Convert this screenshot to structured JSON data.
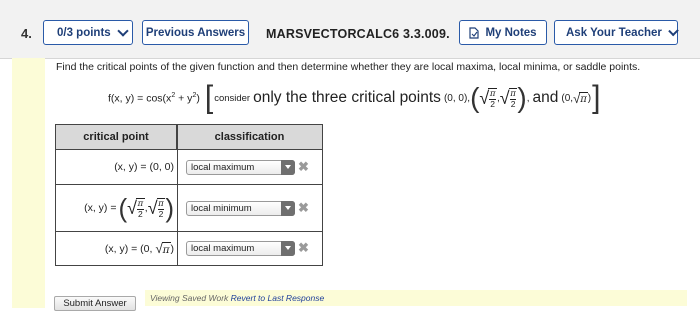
{
  "header": {
    "question_number": "4.",
    "points_label": "0/3 points",
    "previous_answers_label": "Previous Answers",
    "question_id": "MARSVECTORCALC6 3.3.009.",
    "my_notes_label": "My Notes",
    "ask_teacher_label": "Ask Your Teacher"
  },
  "question": {
    "prompt": "Find the critical points of the given function and then determine whether they are local maxima, local minima, or saddle points.",
    "function_lhs": "f(x, y) = cos(x",
    "function_mid": " + y",
    "function_end": ")",
    "sup": "2",
    "consider": "consider",
    "only_text": "only the three critical points",
    "point1": "(0, 0),",
    "and_text": "and",
    "point3_start": "(0, ",
    "point3_end": ")",
    "pi": "π",
    "two": "2",
    "comma": ","
  },
  "table": {
    "headers": [
      "critical point",
      "classification"
    ],
    "rows": [
      {
        "point_text": "(x, y) = (0, 0)",
        "classification": "local maximum"
      },
      {
        "point_prefix": "(x, y) =",
        "classification": "local minimum"
      },
      {
        "point_prefix": "(x, y) = (0,",
        "point_suffix": ")",
        "classification": "local maximum"
      }
    ],
    "clear_icon": "✖"
  },
  "footer": {
    "submit_label": "Submit Answer",
    "viewing_saved": "Viewing Saved Work",
    "revert_label": "Revert to Last Response"
  },
  "colors": {
    "accent": "#2a5aa8",
    "highlight": "#fcfcd7"
  }
}
